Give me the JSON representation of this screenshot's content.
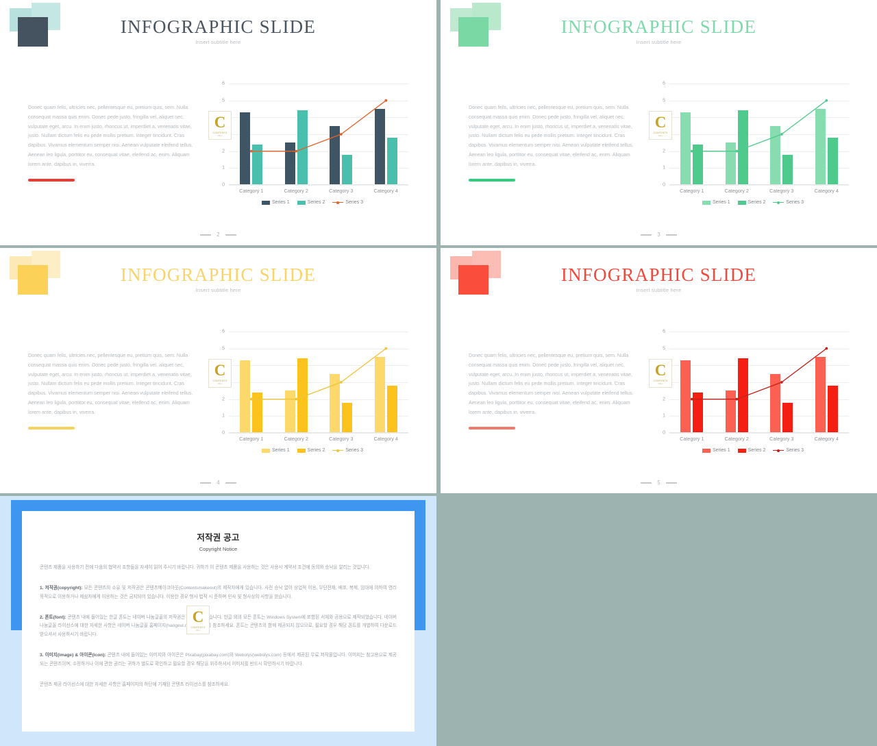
{
  "slides": [
    {
      "page": "2",
      "title": "INFOGRAPHIC SLIDE",
      "subtitle": "Insert subtitle here",
      "title_color": "#4a5560",
      "rule_color": "#ef3b33",
      "deco": {
        "a": "#b8e0dc",
        "b": "#c4e7e3",
        "c": "#44535f"
      },
      "palette": {
        "series1": "#3f5563",
        "series2": "#4bbfae",
        "series3": "#e2622a"
      },
      "body": "Donec quam felis, ultricies nec, pellentesque eu, pretium quis, sem. Nulla consequat massa quis enim. Donec pede justo, fringilla vel, aliquet nec, vulputate eget, arcu. In enim justo, rhoncus ut, imperdiet a, venenatis vitae, justo. Nullam dictum felis eu pede mollis pretium. Integer tincidunt. Cras dapibus. Vivamus elementum semper nisi. Aenean vulputate eleifend tellus. Aenean leo ligula, porttitor eu, consequat vitae, eleifend ac, enim. Aliquam lorem ante, dapibus in, viverra.",
      "chart_data": {
        "type": "bar",
        "title": "",
        "xlabel": "",
        "ylabel": "",
        "categories": [
          "Category 1",
          "Category 2",
          "Category 3",
          "Category 4"
        ],
        "yticks": [
          0,
          1,
          2,
          3,
          4,
          5,
          6
        ],
        "ylim": [
          0,
          6
        ],
        "grid": true,
        "legend_position": "bottom",
        "series": [
          {
            "name": "Series 1",
            "type": "bar",
            "values": [
              4.3,
              2.5,
              3.5,
              4.5
            ]
          },
          {
            "name": "Series 2",
            "type": "bar",
            "values": [
              2.4,
              4.4,
              1.8,
              2.8
            ]
          },
          {
            "name": "Series 3",
            "type": "line",
            "values": [
              2.0,
              2.0,
              3.0,
              5.0
            ]
          }
        ]
      }
    },
    {
      "page": "3",
      "title": "INFOGRAPHIC SLIDE",
      "subtitle": "Insert subtitle here",
      "title_color": "#7fd9ab",
      "rule_color": "#2ecf7d",
      "deco": {
        "a": "#bfe9d1",
        "b": "#b9e8cd",
        "c": "#7ad8a4"
      },
      "palette": {
        "series1": "#87ddb0",
        "series2": "#4ecb8c",
        "series3": "#4ecb8c"
      },
      "body": "Donec quam felis, ultricies nec, pellentesque eu, pretium quis, sem. Nulla consequat massa quis enim. Donec pede justo, fringilla vel, aliquet nec, vulputate eget, arcu. In enim justo, rhoncus ut, imperdiet a, venenatis vitae, justo. Nullam dictum felis eu pede mollis pretium. Integer tincidunt. Cras dapibus. Vivamus elementum semper nisi. Aenean vulputate eleifend tellus. Aenean leo ligula, porttitor eu, consequat vitae, eleifend ac, enim. Aliquam lorem ante, dapibus in, viverra.",
      "chart_data": {
        "type": "bar",
        "title": "",
        "xlabel": "",
        "ylabel": "",
        "categories": [
          "Category 1",
          "Category 2",
          "Category 3",
          "Category 4"
        ],
        "yticks": [
          0,
          1,
          2,
          3,
          4,
          5,
          6
        ],
        "ylim": [
          0,
          6
        ],
        "grid": true,
        "legend_position": "bottom",
        "series": [
          {
            "name": "Series 1",
            "type": "bar",
            "values": [
              4.3,
              2.5,
              3.5,
              4.5
            ]
          },
          {
            "name": "Series 2",
            "type": "bar",
            "values": [
              2.4,
              4.4,
              1.8,
              2.8
            ]
          },
          {
            "name": "Series 3",
            "type": "line",
            "values": [
              2.0,
              2.0,
              3.0,
              5.0
            ]
          }
        ]
      }
    },
    {
      "page": "4",
      "title": "INFOGRAPHIC SLIDE",
      "subtitle": "Insert subtitle here",
      "title_color": "#fad46a",
      "rule_color": "#f5d25c",
      "deco": {
        "a": "#fde9b6",
        "b": "#fdeec6",
        "c": "#fbd158"
      },
      "palette": {
        "series1": "#fdd96b",
        "series2": "#fcc31c",
        "series3": "#f0c33c"
      },
      "body": "Donec quam felis, ultricies nec, pellentesque eu, pretium quis, sem. Nulla consequat massa quis enim. Donec pede justo, fringilla vel, aliquet nec, vulputate eget, arcu. In enim justo, rhoncus ut, imperdiet a, venenatis vitae, justo. Nullam dictum felis eu pede mollis pretium. Integer tincidunt. Cras dapibus. Vivamus elementum semper nisi. Aenean vulputate eleifend tellus. Aenean leo ligula, porttitor eu, consequat vitae, eleifend ac, enim. Aliquam lorem ante, dapibus in, viverra.",
      "chart_data": {
        "type": "bar",
        "title": "",
        "xlabel": "",
        "ylabel": "",
        "categories": [
          "Category 1",
          "Category 2",
          "Category 3",
          "Category 4"
        ],
        "yticks": [
          0,
          1,
          2,
          3,
          4,
          5,
          6
        ],
        "ylim": [
          0,
          6
        ],
        "grid": true,
        "legend_position": "bottom",
        "series": [
          {
            "name": "Series 1",
            "type": "bar",
            "values": [
              4.3,
              2.5,
              3.5,
              4.5
            ]
          },
          {
            "name": "Series 2",
            "type": "bar",
            "values": [
              2.4,
              4.4,
              1.8,
              2.8
            ]
          },
          {
            "name": "Series 3",
            "type": "line",
            "values": [
              2.0,
              2.0,
              3.0,
              5.0
            ]
          }
        ]
      }
    },
    {
      "page": "5",
      "title": "INFOGRAPHIC SLIDE",
      "subtitle": "Insert subtitle here",
      "title_color": "#ef4a3c",
      "rule_color": "#f0796b",
      "deco": {
        "a": "#fbb7ae",
        "b": "#fbbdb4",
        "c": "#fa4d3c"
      },
      "palette": {
        "series1": "#fa6152",
        "series2": "#f41f12",
        "series3": "#c4201a"
      },
      "body": "Donec quam felis, ultricies nec, pellentesque eu, pretium quis, sem. Nulla consequat massa quis enim. Donec pede justo, fringilla vel, aliquet nec, vulputate eget, arcu. In enim justo, rhoncus ut, imperdiet a, venenatis vitae, justo. Nullam dictum felis eu pede mollis pretium. Integer tincidunt. Cras dapibus. Vivamus elementum semper nisi. Aenean vulputate eleifend tellus. Aenean leo ligula, porttitor eu, consequat vitae, eleifend ac, enim. Aliquam lorem ante, dapibus in, viverra.",
      "chart_data": {
        "type": "bar",
        "title": "",
        "xlabel": "",
        "ylabel": "",
        "categories": [
          "Category 1",
          "Category 2",
          "Category 3",
          "Category 4"
        ],
        "yticks": [
          0,
          1,
          2,
          3,
          4,
          5,
          6
        ],
        "ylim": [
          0,
          6
        ],
        "grid": true,
        "legend_position": "bottom",
        "series": [
          {
            "name": "Series 1",
            "type": "bar",
            "values": [
              4.3,
              2.5,
              3.5,
              4.5
            ]
          },
          {
            "name": "Series 2",
            "type": "bar",
            "values": [
              2.4,
              4.4,
              1.8,
              2.8
            ]
          },
          {
            "name": "Series 3",
            "type": "line",
            "values": [
              2.0,
              2.0,
              3.0,
              5.0
            ]
          }
        ]
      }
    }
  ],
  "watermark": {
    "letter": "C",
    "line1": "CONTENTS",
    "line2": "MALL"
  },
  "copyright_slide": {
    "title": "저작권 공고",
    "subtitle": "Copyright Notice",
    "p_intro": "콘텐츠 제품을 사용하기 전에 다음의 협약서 조항들을 자세히 읽어 주시기 바랍니다. 귀하가 이 콘텐츠 제품을 사용하는 것은 사용시 계약서 조건에 동의와 승낙을 알리는 것입니다.",
    "p1_label": "1. 저작권(copyright):",
    "p1": "모든 콘텐츠의 소유 및 저작권은 콘텐츠메이크아웃(Contentsmakeout)의 제작자에게 있습니다. 사전 승낙 없이 상업적 이용, 무단전재, 배포, 복제, 임대에 의하여 영리 목적으로 이용하거나 제삼자에게 이용하는 것은 금지되어 있습니다. 이용한 경우 형사 법적 시 준하며 민사 및 형사상의 사항을 받습니다.",
    "p2_label": "2. 폰트(font):",
    "p2": "콘텐츠 내에 들어있는 한글 폰트는 네이버 나눔글꼴의 저작권은 네이버에 있습니다. 한글 외의 모든 폰트는 Windows System에 포함된 서체와 공용으로 제작되었습니다. 네이버 나눔글꼴 라이선스에 대한 자세한 사항은 네이버 나눔글꼴 홈페이지(hangeul.naver.com)를 참조하세요. 폰트는 콘텐츠의 함께 제공되지 않으므로, 필요할 경우 해당 폰트를 개별하여 다운로드 받으셔서 사용하시기 바랍니다.",
    "p3_label": "3. 이미지(image) & 아이콘(icon):",
    "p3": "콘텐츠 내에 들어있는 이미지와 아이콘은 Pixabay(pixabay.com)와 Webolys(webolys.com) 등에서 제공된 무료 저작물입니다. 이미지는 참고용으로 제공되는 콘텐츠이며, 수정하거나 이에 관한 권리는 귀하가 별도로 확인하고 필요할 경우 해당을 위주하셔서 이미지를 반드시 확인하시기 바랍니다.",
    "p_outro": "콘텐츠 제공 라이선스에 대한 자세한 사항은 홈페이지의 하단에 기재된 콘텐츠 라이선스를 참조하세요."
  }
}
